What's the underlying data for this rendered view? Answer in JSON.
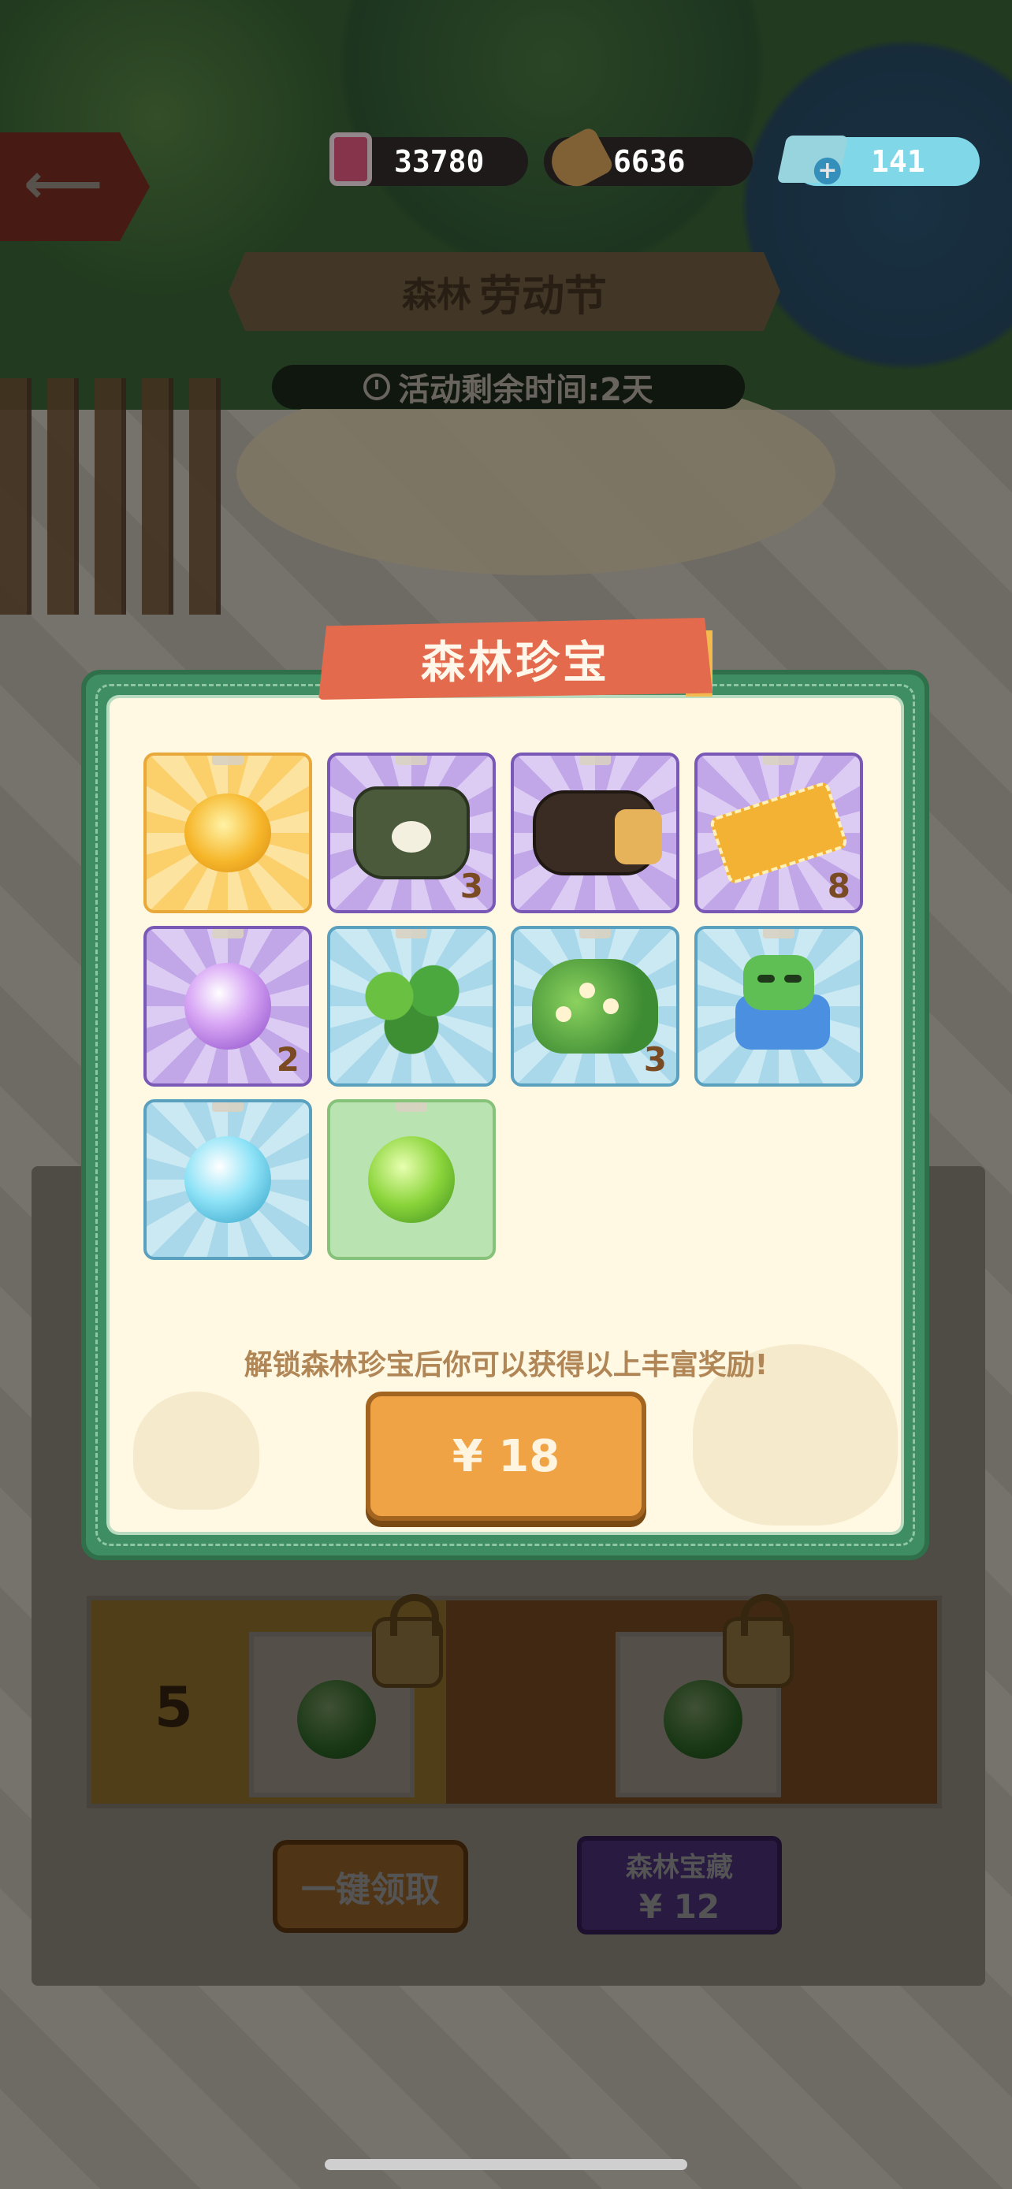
{
  "resources": {
    "ink": {
      "value": "33780",
      "icon": "ink-jar-icon"
    },
    "wood": {
      "value": "6636",
      "icon": "log-icon"
    },
    "gems": {
      "value": "141",
      "icon": "gem-icon"
    }
  },
  "event": {
    "title_small": "森林",
    "title_big": "劳动节",
    "timer": "活动剩余时间:2天"
  },
  "modal": {
    "title": "森林珍宝",
    "items": [
      {
        "name": "golden-flower-orb",
        "rarity": "gold",
        "count": ""
      },
      {
        "name": "green-clover-bag",
        "rarity": "purple",
        "count": "3"
      },
      {
        "name": "black-travel-bag",
        "rarity": "purple",
        "count": ""
      },
      {
        "name": "gold-ticket",
        "rarity": "purple",
        "count": "8"
      },
      {
        "name": "purple-swirl-orb",
        "rarity": "purple",
        "count": "2"
      },
      {
        "name": "green-plant",
        "rarity": "blue",
        "count": ""
      },
      {
        "name": "flower-bush",
        "rarity": "blue",
        "count": "3"
      },
      {
        "name": "robot-cat-bed",
        "rarity": "blue",
        "count": ""
      },
      {
        "name": "blue-crystal-orb",
        "rarity": "blue",
        "count": ""
      },
      {
        "name": "green-crystal-orb",
        "rarity": "green",
        "count": ""
      }
    ],
    "description": "解锁森林珍宝后你可以获得以上丰富奖励!",
    "price": "¥ 18"
  },
  "background_panel": {
    "level": "5",
    "claim_all": "一键领取",
    "treasure_title": "森林宝藏",
    "treasure_price": "¥ 12"
  },
  "colors": {
    "modal_border": "#3f8e63",
    "ribbon": "#e46a4d",
    "price_button": "#f0a345"
  }
}
